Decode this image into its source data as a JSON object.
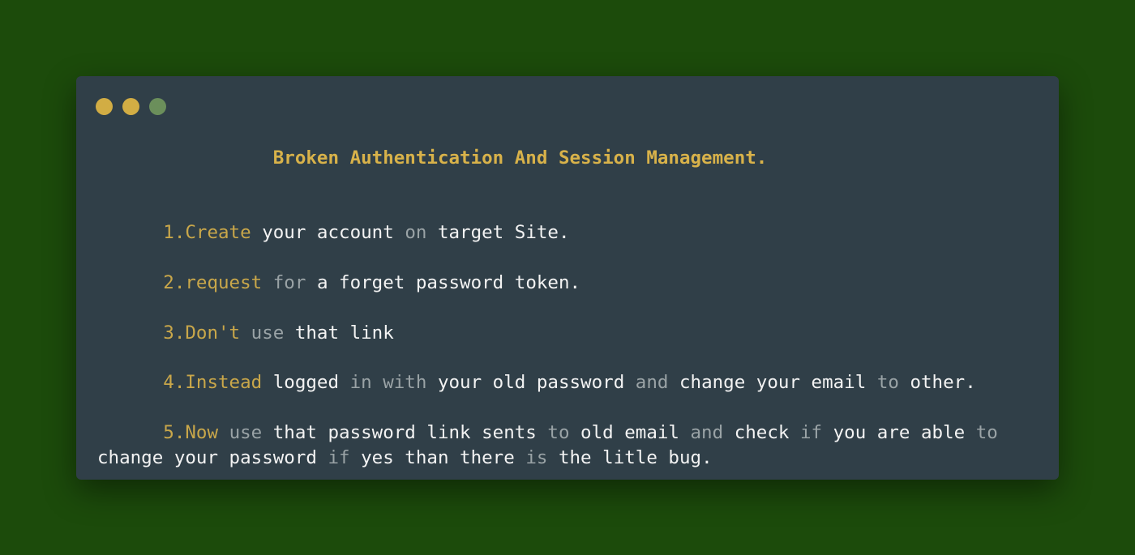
{
  "window": {
    "dots": [
      {
        "name": "dot-1",
        "color": "#d2ad44"
      },
      {
        "name": "dot-2",
        "color": "#d2ad44"
      },
      {
        "name": "dot-3",
        "color": "#6b8f5b"
      }
    ]
  },
  "content": {
    "title": "Broken Authentication And Session Management.",
    "steps": {
      "s1": {
        "a": "1.Create",
        "b": "your account",
        "c": "on",
        "d": "target Site."
      },
      "s2": {
        "a": "2.request",
        "b": "for",
        "c": "a forget password token."
      },
      "s3": {
        "a": "3.Don't",
        "b": "use",
        "c": "that link"
      },
      "s4": {
        "a": "4.Instead",
        "b": "logged",
        "c": "in with",
        "d": "your old password",
        "e": "and",
        "f": "change your email",
        "g": "to",
        "h": "other."
      },
      "s5": {
        "a": "5.Now",
        "b": "use",
        "c": "that password link sents",
        "d": "to",
        "e": "old email",
        "f": "and",
        "g": "check",
        "h": "if",
        "i": "you are able",
        "j": "to",
        "k": "change your password",
        "l": "if",
        "m": "yes than there",
        "n": "is",
        "o": "the litle bug."
      }
    }
  }
}
